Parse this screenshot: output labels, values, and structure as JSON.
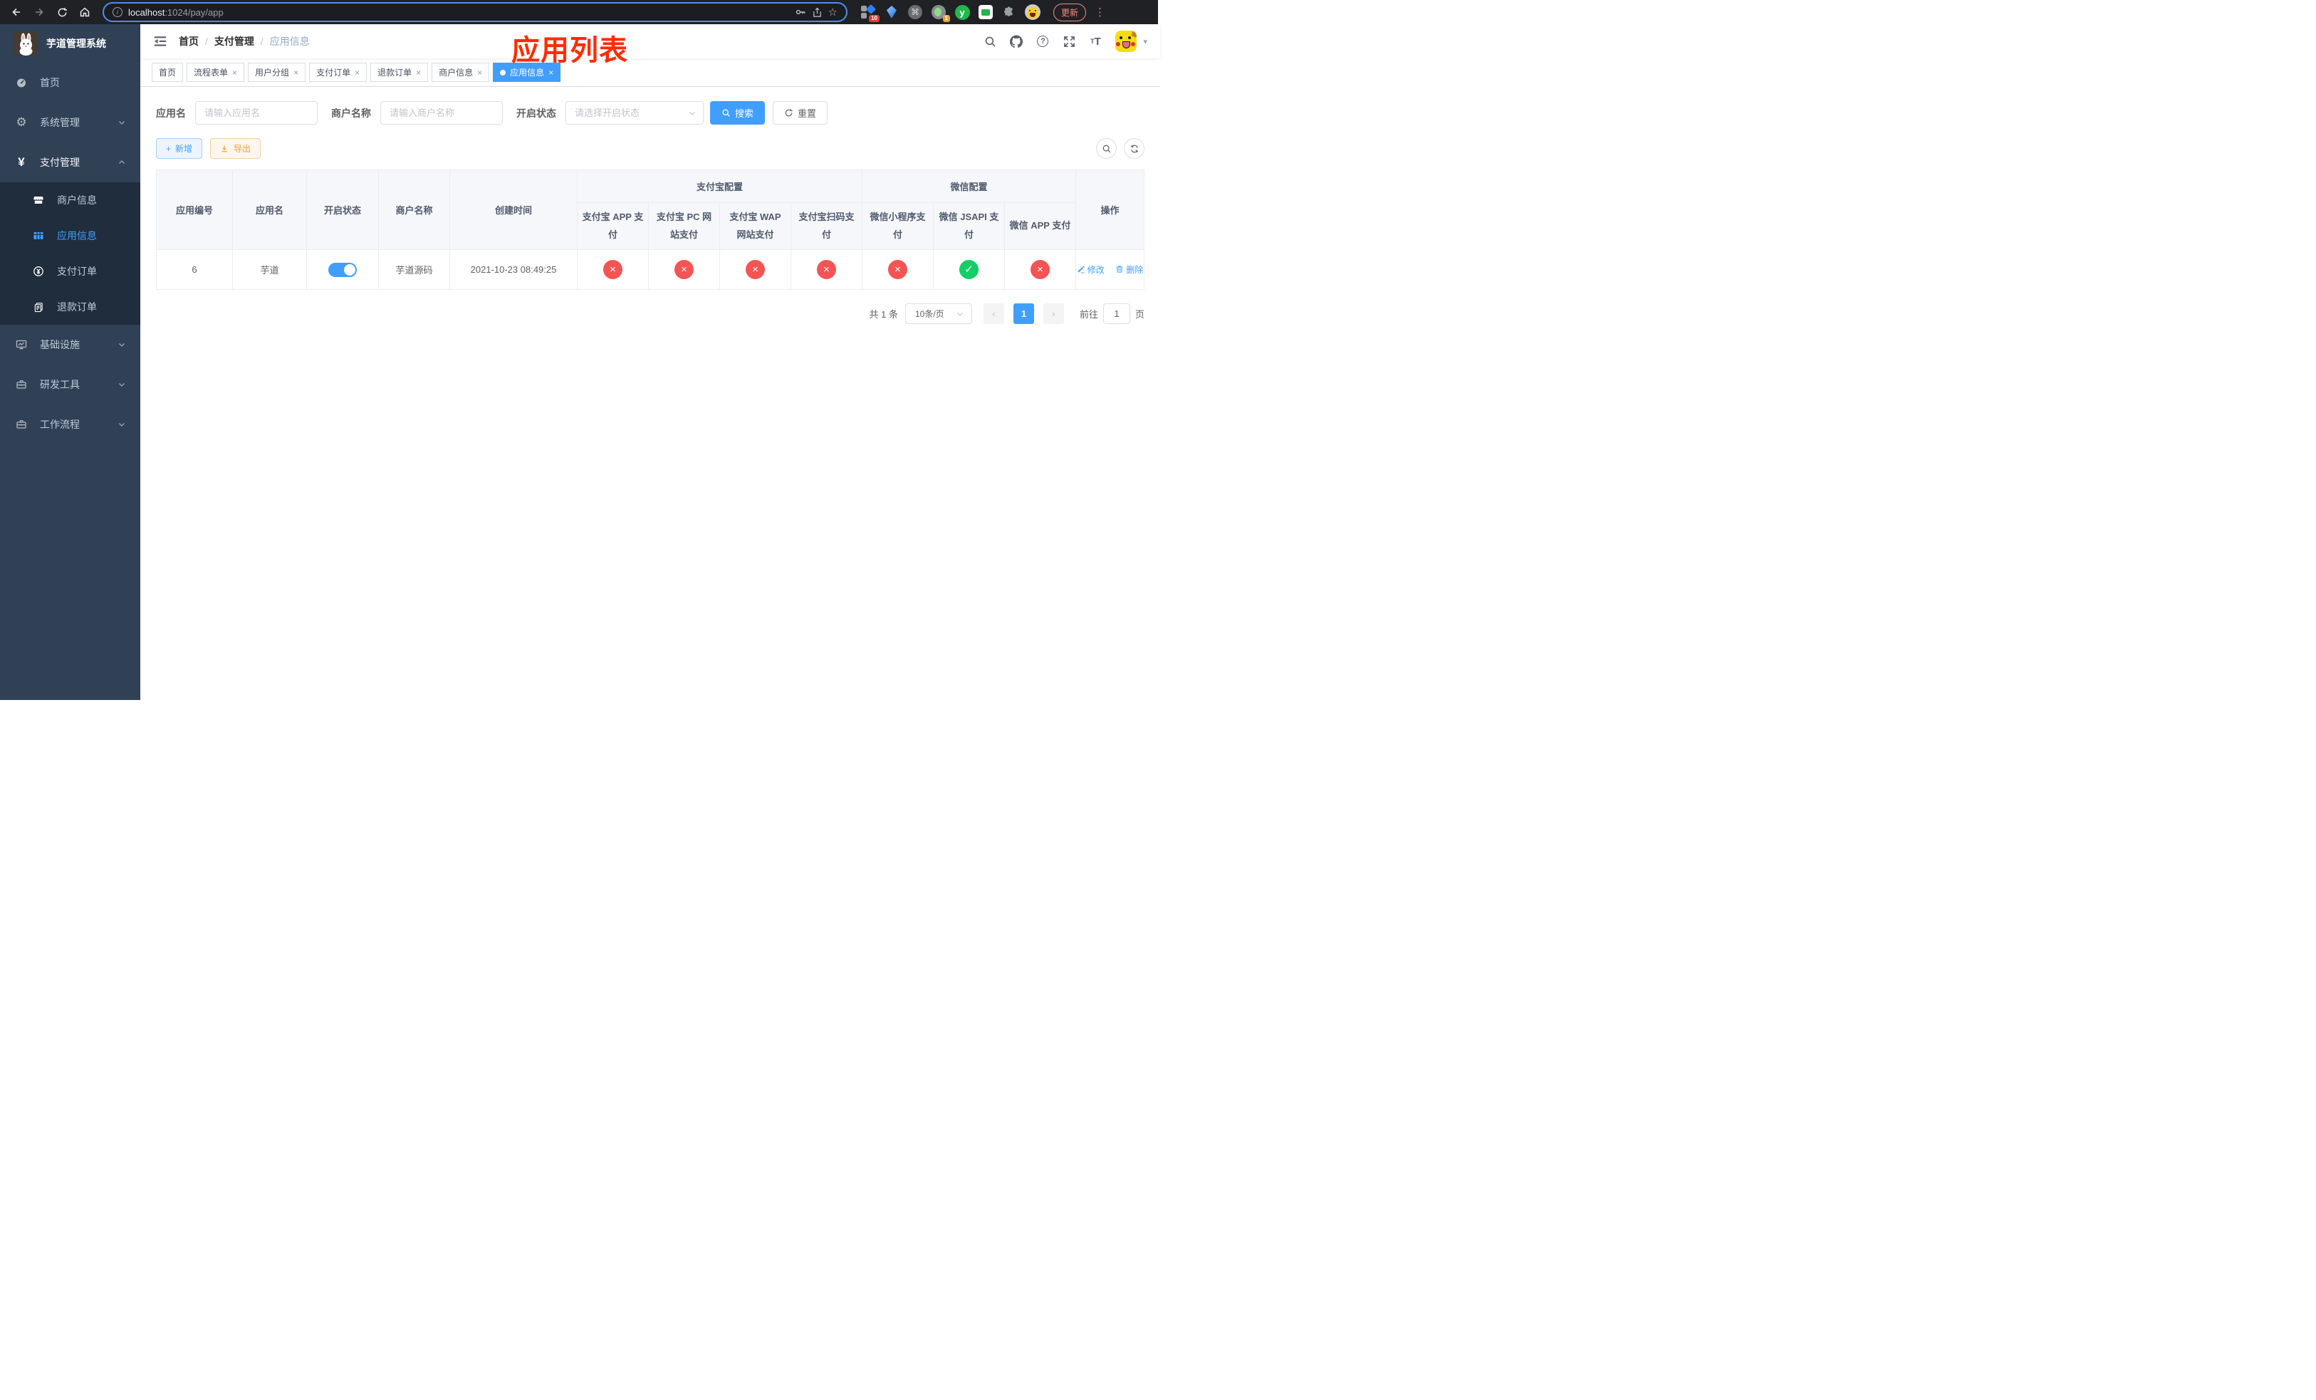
{
  "browser": {
    "url_host": "localhost",
    "url_path": ":1024/pay/app",
    "update_button": "更新",
    "ext_badge_blocks": "10",
    "ext_badge_circle": "1",
    "ext_y_letter": "y"
  },
  "icons": {
    "close": "×",
    "check": "✓",
    "cross": "×",
    "yen": "¥",
    "gear": "⚙",
    "cmd": "⌘",
    "star": "☆",
    "info": "i",
    "help": "?",
    "dots": "⋮",
    "caret": "▾",
    "plus": "+",
    "t_small": "T",
    "t_big": "T"
  },
  "sidebar": {
    "app_title": "芋道管理系统",
    "menu": {
      "home": "首页",
      "system": "系统管理",
      "payment": "支付管理",
      "merchant": "商户信息",
      "app_info": "应用信息",
      "pay_order": "支付订单",
      "refund_order": "退款订单",
      "infra": "基础设施",
      "dev_tools": "研发工具",
      "workflow": "工作流程"
    }
  },
  "navbar": {
    "breadcrumb": {
      "home": "首页",
      "section": "支付管理",
      "current": "应用信息",
      "separator": "/"
    },
    "overlay_title": "应用列表"
  },
  "tabs": {
    "t0": "首页",
    "t1": "流程表单",
    "t2": "用户分组",
    "t3": "支付订单",
    "t4": "退款订单",
    "t5": "商户信息",
    "t6": "应用信息"
  },
  "filters": {
    "app_name_label": "应用名",
    "app_name_placeholder": "请输入应用名",
    "merchant_label": "商户名称",
    "merchant_placeholder": "请输入商户名称",
    "status_label": "开启状态",
    "status_placeholder": "请选择开启状态",
    "search_button": "搜索",
    "reset_button": "重置"
  },
  "toolbar": {
    "add_button": "新增",
    "export_button": "导出"
  },
  "table": {
    "columns": {
      "app_id": "应用编号",
      "app_name": "应用名",
      "open_status": "开启状态",
      "merchant_name": "商户名称",
      "create_time": "创建时间",
      "alipay_group": "支付宝配置",
      "wechat_group": "微信配置",
      "alipay_app": "支付宝 APP 支付",
      "alipay_pc": "支付宝 PC 网站支付",
      "alipay_wap": "支付宝 WAP 网站支付",
      "alipay_qr": "支付宝扫码支付",
      "wx_lite": "微信小程序支付",
      "wx_jsapi": "微信 JSAPI 支付",
      "wx_app": "微信 APP 支付",
      "actions": "操作"
    },
    "row": {
      "app_id": "6",
      "app_name": "芋道",
      "open_status": "on",
      "merchant_name": "芋道源码",
      "create_time": "2021-10-23 08:49:25",
      "configs": [
        "off",
        "off",
        "off",
        "off",
        "off",
        "on",
        "off"
      ],
      "config_marks": [
        "×",
        "×",
        "×",
        "×",
        "×",
        "✓",
        "×"
      ],
      "edit_link": "修改",
      "delete_link": "删除"
    }
  },
  "pagination": {
    "total": "共 1 条",
    "page_size": "10条/页",
    "prev": "‹",
    "page": "1",
    "next": "›",
    "goto_label": "前往",
    "goto_value": "1",
    "page_suffix": "页"
  },
  "colors": {
    "accent": "#409eff",
    "danger": "#f45454",
    "success": "#13ce66",
    "title_red": "#ff2c00"
  }
}
